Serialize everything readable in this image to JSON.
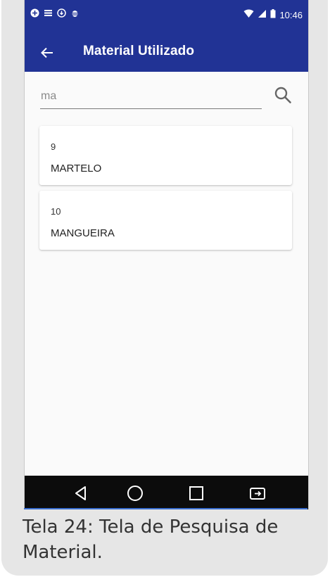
{
  "status_bar": {
    "left_icons": [
      "shield-icon",
      "menu-list-icon",
      "download-icon",
      "bug-icon"
    ],
    "right_icons": [
      "wifi-icon",
      "signal-icon",
      "battery-icon"
    ],
    "time": "10:46"
  },
  "toolbar": {
    "back_icon": "arrow-left-icon",
    "title": "Material Utilizado"
  },
  "search": {
    "value": "ma",
    "icon": "search-icon"
  },
  "results": [
    {
      "code": "9",
      "name": "MARTELO"
    },
    {
      "code": "10",
      "name": "MANGUEIRA"
    }
  ],
  "nav_bar": {
    "icons": [
      "back-triangle-icon",
      "home-circle-icon",
      "recents-square-icon",
      "screen-rotate-icon"
    ]
  },
  "caption": "Tela 24: Tela de Pesquisa de Material.",
  "colors": {
    "app_bar": "#213395",
    "nav_bar": "#0c0c0c",
    "background": "#fafafa"
  }
}
